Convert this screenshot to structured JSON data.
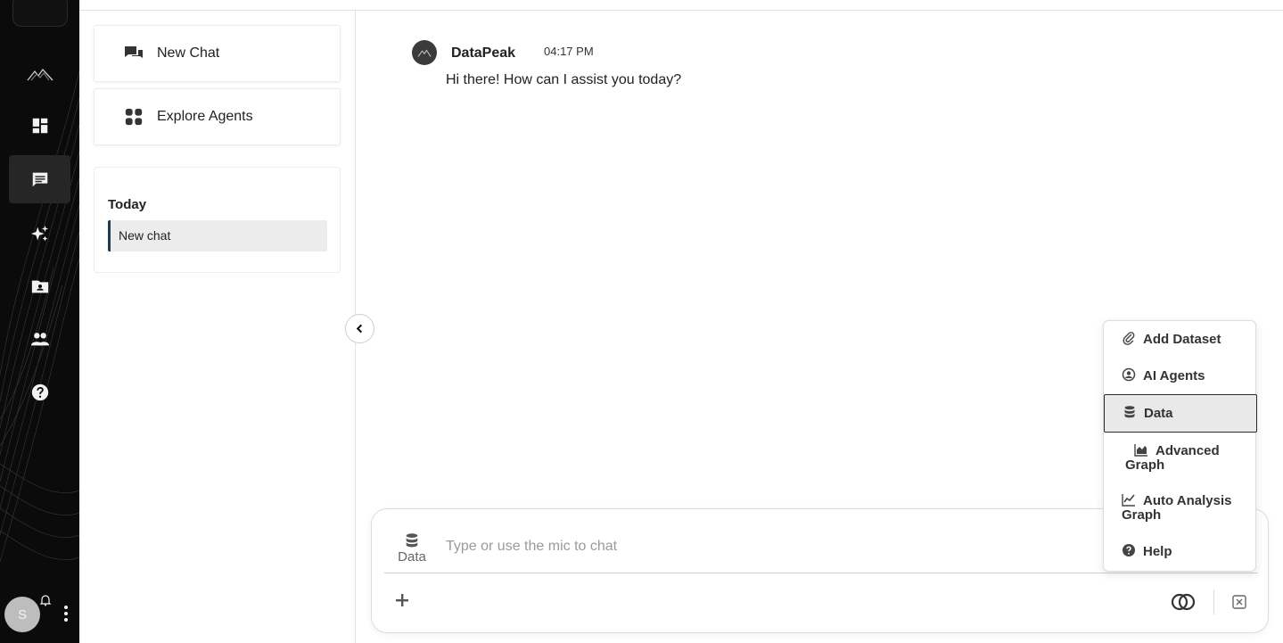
{
  "sidebar": {
    "new_chat_label": "New Chat",
    "explore_agents_label": "Explore Agents",
    "history_day": "Today",
    "history_item": "New chat"
  },
  "user": {
    "initial": "S"
  },
  "message": {
    "sender": "DataPeak",
    "time": "04:17 PM",
    "text": "Hi there! How can I assist you today?"
  },
  "composer": {
    "data_chip_label": "Data",
    "placeholder": "Type or use the mic to chat"
  },
  "menu": {
    "items": [
      {
        "label": "Add Dataset",
        "icon": "paperclip-icon"
      },
      {
        "label": "AI Agents",
        "icon": "agent-icon"
      },
      {
        "label": "Data",
        "icon": "database-icon"
      },
      {
        "label": "Advanced Graph",
        "icon": "area-chart-icon"
      },
      {
        "label": "Auto Analysis Graph",
        "icon": "line-chart-icon"
      },
      {
        "label": "Help",
        "icon": "help-icon"
      }
    ],
    "selected": "Data"
  }
}
